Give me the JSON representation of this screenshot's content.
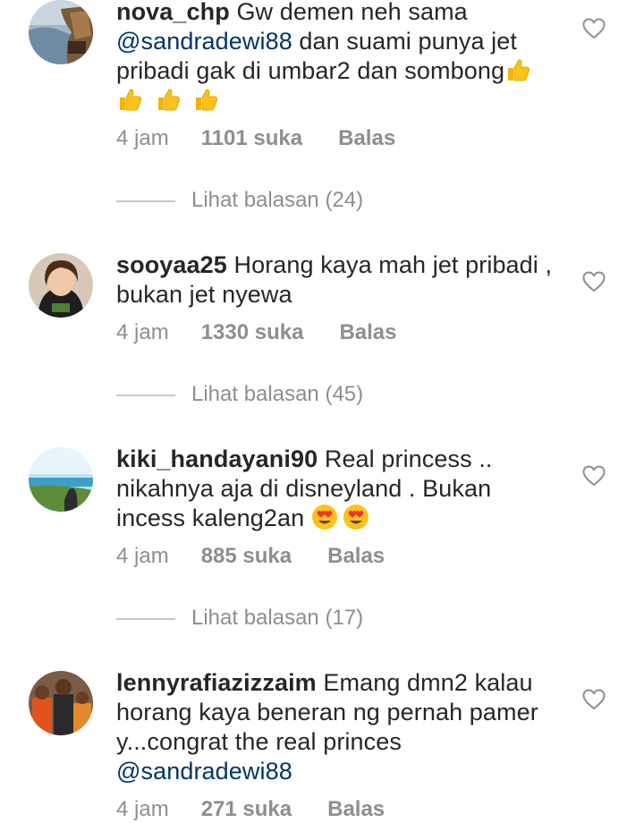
{
  "comments": [
    {
      "username": "nova_chp",
      "text_before": "Gw demen neh sama",
      "mention": "@sandradewi88",
      "text_after": " dan suami punya jet pribadi gak di umbar2 dan sombong",
      "emojis": [
        "thumbs-up",
        "thumbs-up",
        "thumbs-up",
        "thumbs-up"
      ],
      "time": "4 jam",
      "likes": "1101 suka",
      "reply_label": "Balas",
      "view_replies": "Lihat balasan (24)"
    },
    {
      "username": "sooyaa25",
      "text_before": "Horang kaya mah jet pribadi , bukan jet nyewa",
      "time": "4 jam",
      "likes": "1330 suka",
      "reply_label": "Balas",
      "view_replies": "Lihat balasan (45)"
    },
    {
      "username": "kiki_handayani90",
      "text_before": "Real princess .. nikahnya aja di disneyland . Bukan incess kaleng2an",
      "emojis": [
        "heart-eyes",
        "heart-eyes"
      ],
      "time": "4 jam",
      "likes": "885 suka",
      "reply_label": "Balas",
      "view_replies": "Lihat balasan (17)"
    },
    {
      "username": "lennyrafiazizzaim",
      "text_before": "Emang dmn2 kalau horang kaya beneran ng pernah pamer y...congrat the real princes",
      "mention": "@sandradewi88",
      "time": "4 jam",
      "likes": "271 suka",
      "reply_label": "Balas"
    }
  ],
  "colors": {
    "text": "#262626",
    "mention": "#003569",
    "meta": "#8e8e8e",
    "divider": "#c7c7c7"
  },
  "icons": {
    "like": "heart-outline-icon",
    "thumbs_up": "thumbs-up-emoji",
    "heart_eyes": "heart-eyes-emoji"
  }
}
